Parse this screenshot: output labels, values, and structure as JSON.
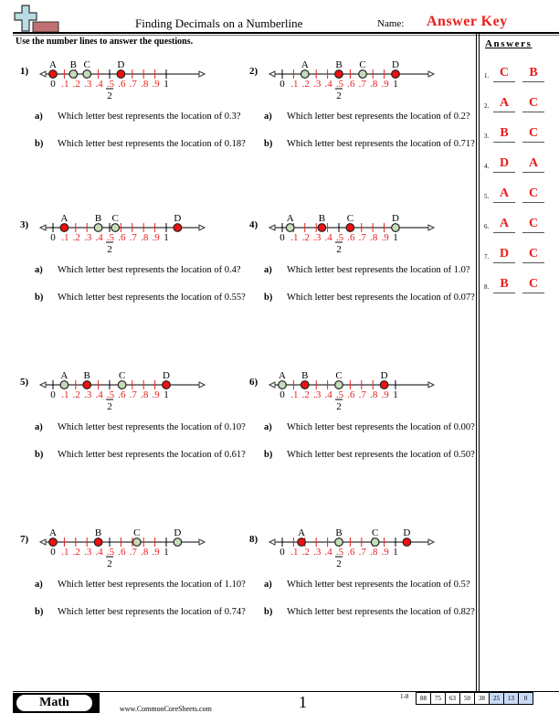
{
  "header": {
    "title": "Finding Decimals on a Numberline",
    "name_label": "Name:",
    "answer_key": "Answer Key",
    "instructions": "Use the number lines to answer the questions."
  },
  "tick_labels": {
    "zero": "0",
    "one": "1",
    "tenths": [
      ".1",
      ".2",
      ".3",
      ".4",
      ".5",
      ".6",
      ".7",
      ".8",
      ".9"
    ],
    "half_num": "1",
    "half_den": "2"
  },
  "colors": {
    "accent_red": "#e8201c",
    "point_red": "#f01010",
    "point_green": "#c4dcb8",
    "axis": "#555555",
    "score_highlight": "#c8daf6"
  },
  "problems": [
    {
      "number": "1)",
      "points": [
        {
          "label": "A",
          "value": 0.0,
          "color": "red"
        },
        {
          "label": "B",
          "value": 0.18,
          "color": "green"
        },
        {
          "label": "C",
          "value": 0.3,
          "color": "green"
        },
        {
          "label": "D",
          "value": 0.6,
          "color": "red"
        }
      ],
      "questions": [
        {
          "letter": "a)",
          "text": "Which letter best represents the location of 0.3?"
        },
        {
          "letter": "b)",
          "text": "Which letter best represents the location of 0.18?"
        }
      ]
    },
    {
      "number": "2)",
      "points": [
        {
          "label": "A",
          "value": 0.2,
          "color": "green"
        },
        {
          "label": "B",
          "value": 0.5,
          "color": "red"
        },
        {
          "label": "C",
          "value": 0.71,
          "color": "green"
        },
        {
          "label": "D",
          "value": 1.0,
          "color": "red"
        }
      ],
      "questions": [
        {
          "letter": "a)",
          "text": "Which letter best represents the location of 0.2?"
        },
        {
          "letter": "b)",
          "text": "Which letter best represents the location of 0.71?"
        }
      ]
    },
    {
      "number": "3)",
      "points": [
        {
          "label": "A",
          "value": 0.1,
          "color": "red"
        },
        {
          "label": "B",
          "value": 0.4,
          "color": "green"
        },
        {
          "label": "C",
          "value": 0.55,
          "color": "green"
        },
        {
          "label": "D",
          "value": 1.1,
          "color": "red"
        }
      ],
      "questions": [
        {
          "letter": "a)",
          "text": "Which letter best represents the location of 0.4?"
        },
        {
          "letter": "b)",
          "text": "Which letter best represents the location of 0.55?"
        }
      ]
    },
    {
      "number": "4)",
      "points": [
        {
          "label": "A",
          "value": 0.07,
          "color": "green"
        },
        {
          "label": "B",
          "value": 0.35,
          "color": "red"
        },
        {
          "label": "C",
          "value": 0.6,
          "color": "red"
        },
        {
          "label": "D",
          "value": 1.0,
          "color": "green"
        }
      ],
      "questions": [
        {
          "letter": "a)",
          "text": "Which letter best represents the location of 1.0?"
        },
        {
          "letter": "b)",
          "text": "Which letter best represents the location of 0.07?"
        }
      ]
    },
    {
      "number": "5)",
      "points": [
        {
          "label": "A",
          "value": 0.1,
          "color": "green"
        },
        {
          "label": "B",
          "value": 0.3,
          "color": "red"
        },
        {
          "label": "C",
          "value": 0.61,
          "color": "green"
        },
        {
          "label": "D",
          "value": 1.0,
          "color": "red"
        }
      ],
      "questions": [
        {
          "letter": "a)",
          "text": "Which letter best represents the location of 0.10?"
        },
        {
          "letter": "b)",
          "text": "Which letter best represents the location of 0.61?"
        }
      ]
    },
    {
      "number": "6)",
      "points": [
        {
          "label": "A",
          "value": 0.0,
          "color": "green"
        },
        {
          "label": "B",
          "value": 0.2,
          "color": "red"
        },
        {
          "label": "C",
          "value": 0.5,
          "color": "green"
        },
        {
          "label": "D",
          "value": 0.9,
          "color": "red"
        }
      ],
      "questions": [
        {
          "letter": "a)",
          "text": "Which letter best represents the location of 0.00?"
        },
        {
          "letter": "b)",
          "text": "Which letter best represents the location of 0.50?"
        }
      ]
    },
    {
      "number": "7)",
      "points": [
        {
          "label": "A",
          "value": 0.0,
          "color": "red"
        },
        {
          "label": "B",
          "value": 0.4,
          "color": "red"
        },
        {
          "label": "C",
          "value": 0.74,
          "color": "green"
        },
        {
          "label": "D",
          "value": 1.1,
          "color": "green"
        }
      ],
      "questions": [
        {
          "letter": "a)",
          "text": "Which letter best represents the location of 1.10?"
        },
        {
          "letter": "b)",
          "text": "Which letter best represents the location of 0.74?"
        }
      ]
    },
    {
      "number": "8)",
      "points": [
        {
          "label": "A",
          "value": 0.17,
          "color": "red"
        },
        {
          "label": "B",
          "value": 0.5,
          "color": "green"
        },
        {
          "label": "C",
          "value": 0.82,
          "color": "green"
        },
        {
          "label": "D",
          "value": 1.1,
          "color": "red"
        }
      ],
      "questions": [
        {
          "letter": "a)",
          "text": "Which letter best represents the location of 0.5?"
        },
        {
          "letter": "b)",
          "text": "Which letter best represents the location of 0.82?"
        }
      ]
    }
  ],
  "answers": {
    "title": "Answers",
    "rows": [
      {
        "num": "1.",
        "a": "C",
        "b": "B"
      },
      {
        "num": "2.",
        "a": "A",
        "b": "C"
      },
      {
        "num": "3.",
        "a": "B",
        "b": "C"
      },
      {
        "num": "4.",
        "a": "D",
        "b": "A"
      },
      {
        "num": "5.",
        "a": "A",
        "b": "C"
      },
      {
        "num": "6.",
        "a": "A",
        "b": "C"
      },
      {
        "num": "7.",
        "a": "D",
        "b": "C"
      },
      {
        "num": "8.",
        "a": "B",
        "b": "C"
      }
    ]
  },
  "footer": {
    "subject": "Math",
    "url": "www.CommonCoreSheets.com",
    "page": "1",
    "score_label": "1-8",
    "scores": [
      {
        "value": "88",
        "highlight": false
      },
      {
        "value": "75",
        "highlight": false
      },
      {
        "value": "63",
        "highlight": false
      },
      {
        "value": "50",
        "highlight": false
      },
      {
        "value": "38",
        "highlight": false
      },
      {
        "value": "25",
        "highlight": true
      },
      {
        "value": "13",
        "highlight": true
      },
      {
        "value": "0",
        "highlight": true
      }
    ]
  }
}
